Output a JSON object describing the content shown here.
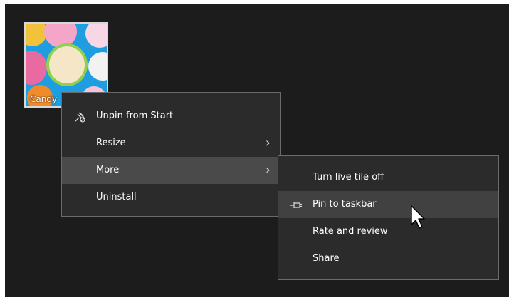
{
  "tile": {
    "label": "Candy"
  },
  "context_menu": {
    "items": [
      {
        "label": "Unpin from Start",
        "icon": "unpin-icon"
      },
      {
        "label": "Resize",
        "icon": "chevron-right-icon"
      },
      {
        "label": "More",
        "icon": "chevron-right-icon"
      },
      {
        "label": "Uninstall"
      }
    ]
  },
  "submenu": {
    "items": [
      {
        "label": "Turn live tile off"
      },
      {
        "label": "Pin to taskbar",
        "icon": "pin-icon"
      },
      {
        "label": "Rate and review"
      },
      {
        "label": "Share"
      }
    ]
  },
  "colors": {
    "background": "#1c1c1c",
    "menu": "#2b2b2b",
    "menu_border": "#6a6a6a",
    "highlight": "#4a4a4a",
    "tile_blue": "#1e9ee0"
  }
}
